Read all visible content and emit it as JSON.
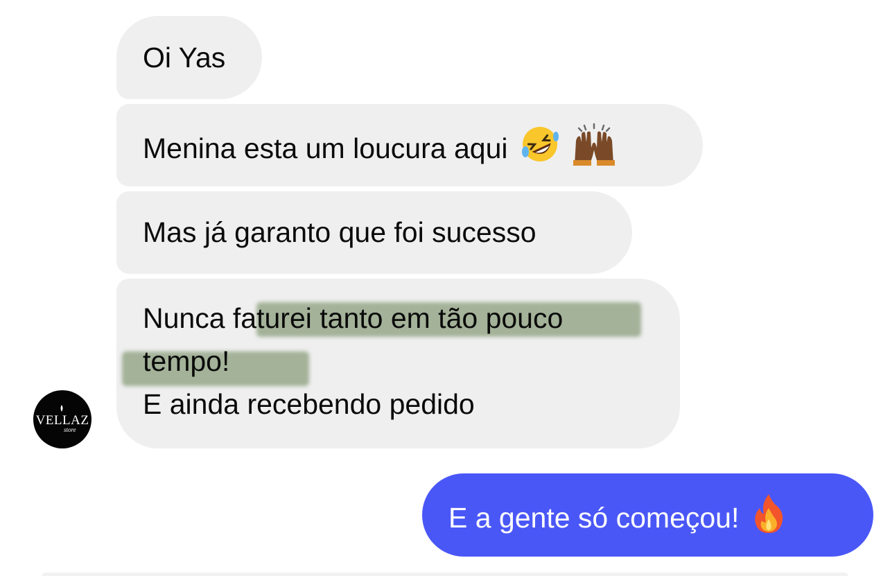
{
  "messages": {
    "received": [
      {
        "text": "Oi Yas"
      },
      {
        "text": "Menina esta um loucura aqui",
        "emojis": [
          "rolling-on-floor-laughing-emoji",
          "raising-hands-emoji"
        ]
      },
      {
        "text": "Mas já garanto que foi sucesso"
      },
      {
        "lines": [
          "Nunca faturei tanto em tão pouco",
          "tempo!",
          "E ainda recebendo pedido"
        ]
      }
    ],
    "sent": [
      {
        "text": "E a gente só começou!",
        "emoji": "fire-emoji"
      }
    ]
  },
  "avatar": {
    "brand": "VELLAZ",
    "sub": "store"
  },
  "colors": {
    "received_bubble": "#efefef",
    "sent_bubble": "#4a57f7",
    "highlight": "#64805a"
  }
}
